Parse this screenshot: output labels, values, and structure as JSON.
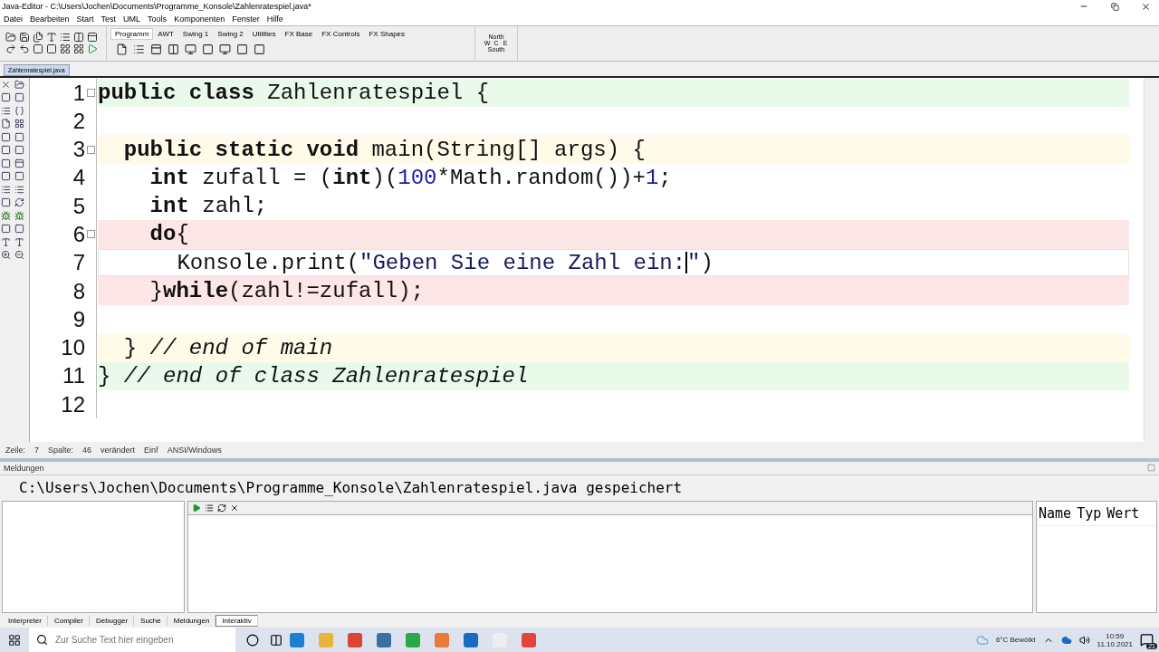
{
  "window": {
    "title": "Java-Editor - C:\\Users\\Jochen\\Documents\\Programme_Konsole\\Zahlenratespiel.java*"
  },
  "menu": [
    "Datei",
    "Bearbeiten",
    "Start",
    "Test",
    "UML",
    "Tools",
    "Komponenten",
    "Fenster",
    "Hilfe"
  ],
  "palette_tabs": [
    {
      "label": "Programm",
      "selected": true
    },
    {
      "label": "AWT",
      "selected": false
    },
    {
      "label": "Swing 1",
      "selected": false
    },
    {
      "label": "Swing 2",
      "selected": false
    },
    {
      "label": "Utilities",
      "selected": false
    },
    {
      "label": "FX Base",
      "selected": false
    },
    {
      "label": "FX Controls",
      "selected": false
    },
    {
      "label": "FX Shapes",
      "selected": false
    }
  ],
  "layout_picker": {
    "north": "North",
    "west": "W",
    "center": "C",
    "east": "E",
    "south": "South"
  },
  "file_tabs": [
    {
      "label": "Zahlenratespiel.java",
      "selected": true
    }
  ],
  "code_lines": [
    {
      "number": "1",
      "kind": "class",
      "foldable": true,
      "current": false,
      "tokens": [
        {
          "text": "public class",
          "kind": "kw"
        },
        {
          "text": " Zahlenratespiel {",
          "kind": "text"
        }
      ]
    },
    {
      "number": "2",
      "foldable": false,
      "current": false
    },
    {
      "number": "3",
      "kind": "method",
      "foldable": true,
      "current": false,
      "tokens": [
        {
          "text": "  public static void",
          "kind": "kw"
        },
        {
          "text": " main(String[] args) {",
          "kind": "text"
        }
      ]
    },
    {
      "number": "4",
      "kind": "plain",
      "foldable": false,
      "current": false,
      "tokens": [
        {
          "text": "    int",
          "kind": "kw"
        },
        {
          "text": " zufall = (",
          "kind": "text"
        },
        {
          "text": "int",
          "kind": "kw"
        },
        {
          "text": ")(",
          "kind": "text"
        },
        {
          "text": "100",
          "kind": "num"
        },
        {
          "text": "*Math.random())+",
          "kind": "text"
        },
        {
          "text": "1",
          "kind": "num"
        },
        {
          "text": ";",
          "kind": "text"
        }
      ]
    },
    {
      "number": "5",
      "kind": "plain",
      "foldable": false,
      "current": false,
      "tokens": [
        {
          "text": "    int",
          "kind": "kw"
        },
        {
          "text": " zahl;",
          "kind": "text"
        }
      ]
    },
    {
      "number": "6",
      "kind": "loop",
      "foldable": true,
      "current": false,
      "tokens": [
        {
          "text": "    do",
          "kind": "kw"
        },
        {
          "text": "{",
          "kind": "text"
        }
      ]
    },
    {
      "number": "7",
      "kind": "loop",
      "foldable": false,
      "current": true,
      "tokens": [
        {
          "text": "      Konsole.print(",
          "kind": "text"
        },
        {
          "text": "\"Geben Sie eine Zahl ein:",
          "kind": "str"
        },
        {
          "text": "\"",
          "kind": "str"
        },
        {
          "text": ")",
          "kind": "text"
        }
      ]
    },
    {
      "number": "8",
      "kind": "loop",
      "foldable": false,
      "current": false,
      "tokens": [
        {
          "text": "    }",
          "kind": "text"
        },
        {
          "text": "while",
          "kind": "kw"
        },
        {
          "text": "(zahl!=zufall);",
          "kind": "text"
        }
      ]
    },
    {
      "number": "9",
      "foldable": false,
      "current": false
    },
    {
      "number": "10",
      "kind": "method",
      "foldable": false,
      "current": false,
      "tokens": [
        {
          "text": "  } ",
          "kind": "text"
        },
        {
          "text": "// end of main",
          "kind": "comment"
        }
      ]
    },
    {
      "number": "11",
      "kind": "class",
      "foldable": false,
      "current": false,
      "tokens": [
        {
          "text": "} ",
          "kind": "text"
        },
        {
          "text": "// end of class Zahlenratespiel",
          "kind": "comment"
        }
      ]
    },
    {
      "number": "12",
      "foldable": false,
      "current": false
    }
  ],
  "status_bar": [
    "Zeile:",
    "7",
    "Spalte:",
    "46",
    "verändert",
    "Einf",
    "ANSI/Windows"
  ],
  "messages": {
    "title": "Meldungen",
    "text": "C:\\Users\\Jochen\\Documents\\Programme_Konsole\\Zahlenratespiel.java gespeichert"
  },
  "variables": {
    "columns": [
      "Name",
      "Typ",
      "Wert"
    ]
  },
  "bottom_tabs": [
    {
      "label": "Interpreter",
      "selected": false
    },
    {
      "label": "Compiler",
      "selected": false
    },
    {
      "label": "Debugger",
      "selected": false
    },
    {
      "label": "Suche",
      "selected": false
    },
    {
      "label": "Meldungen",
      "selected": false
    },
    {
      "label": "Interaktiv",
      "selected": true
    }
  ],
  "taskbar": {
    "search_placeholder": "Zur Suche Text hier eingeben",
    "weather": "6°C  Bewölkt",
    "time": "10:59",
    "date": "11.10.2021",
    "notifications": "21"
  }
}
